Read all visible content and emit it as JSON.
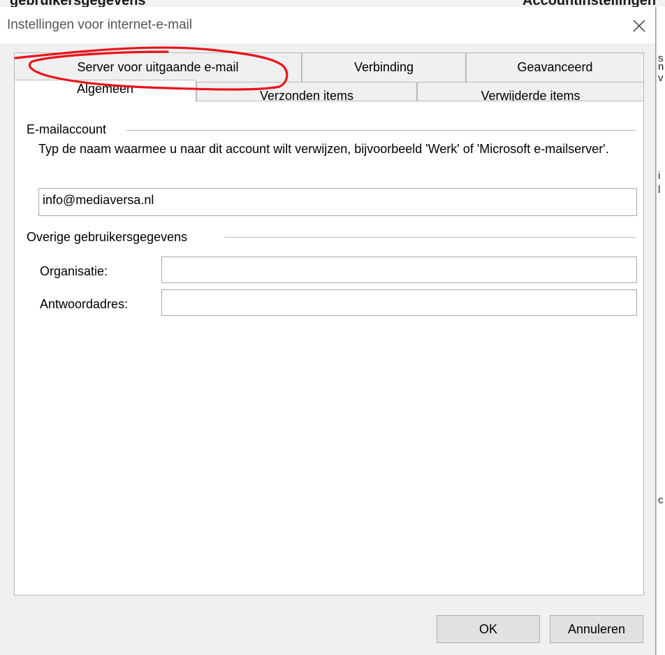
{
  "background": {
    "top_fragments": [
      "gebruikersgegevens",
      "Accountinstellingen"
    ],
    "right_chars": [
      "s",
      "n",
      "v",
      "i",
      "l",
      "c"
    ]
  },
  "dialog": {
    "title": "Instellingen voor internet-e-mail",
    "tabs_back": [
      "Server voor uitgaande e-mail",
      "Verbinding",
      "Geavanceerd"
    ],
    "tabs_front": [
      "Algemeen",
      "Verzonden items",
      "Verwijderde items"
    ],
    "active_tab": "Algemeen"
  },
  "general": {
    "account_group": "E-mailaccount",
    "account_description": "Typ de naam waarmee u naar dit account wilt verwijzen, bijvoorbeeld 'Werk' of 'Microsoft e-mailserver'.",
    "account_name_value": "info@mediaversa.nl",
    "other_group": "Overige gebruikersgegevens",
    "organization_label": "Organisatie:",
    "organization_value": "",
    "reply_label": "Antwoordadres:",
    "reply_value": ""
  },
  "buttons": {
    "ok": "OK",
    "cancel": "Annuleren"
  },
  "annotation": {
    "color": "#e8141b"
  }
}
